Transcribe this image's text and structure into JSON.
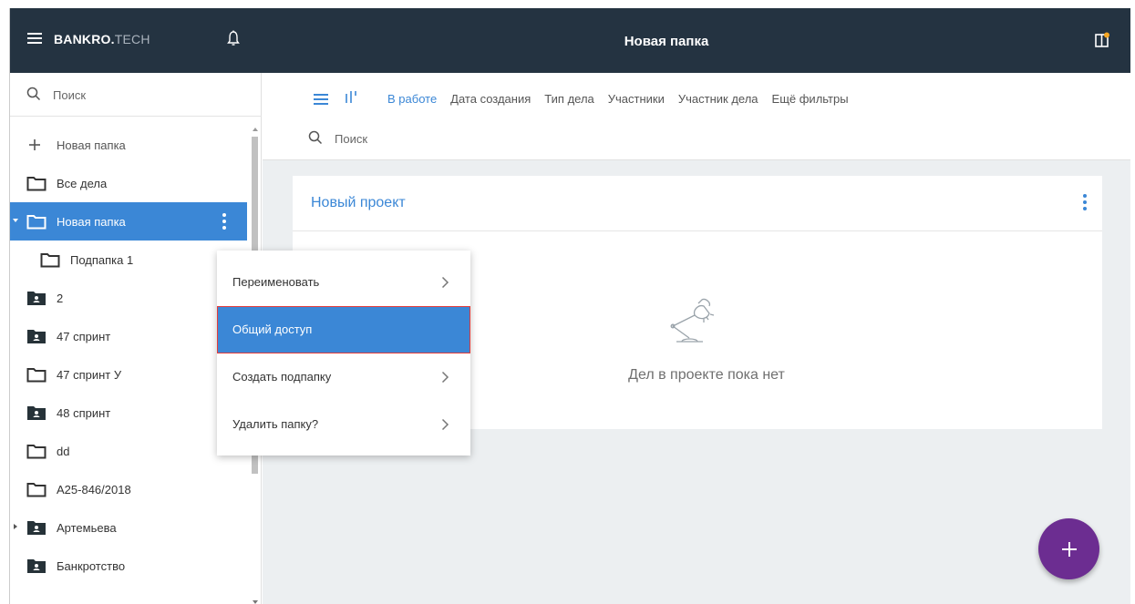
{
  "app": {
    "logo_bold": "BANKRO.",
    "logo_light": "TECH",
    "title": "Новая папка"
  },
  "sidebar": {
    "search_placeholder": "Поиск",
    "new_folder_label": "Новая папка",
    "items": [
      {
        "label": "Все дела",
        "icon": "folder-icon"
      },
      {
        "label": "Новая папка",
        "icon": "folder-icon",
        "active": true
      },
      {
        "label": "Подпапка 1",
        "icon": "folder-icon"
      },
      {
        "label": "2",
        "icon": "shared-folder-icon"
      },
      {
        "label": "47 спринт",
        "icon": "shared-folder-icon"
      },
      {
        "label": "47 спринт У",
        "icon": "folder-icon"
      },
      {
        "label": "48 спринт",
        "icon": "shared-folder-icon"
      },
      {
        "label": "dd",
        "icon": "folder-icon"
      },
      {
        "label": "А25-846/2018",
        "icon": "folder-icon"
      },
      {
        "label": "Артемьева",
        "icon": "shared-folder-icon"
      },
      {
        "label": "Банкротство",
        "icon": "shared-folder-icon"
      }
    ]
  },
  "toolbar": {
    "filters": [
      "В работе",
      "Дата создания",
      "Тип дела",
      "Участники",
      "Участник дела",
      "Ещё фильтры"
    ],
    "active_filter": "В работе",
    "search_placeholder": "Поиск"
  },
  "project": {
    "title": "Новый проект",
    "empty_text": "Дел в проекте пока нет"
  },
  "context_menu": {
    "items": [
      {
        "label": "Переименовать",
        "has_submenu": true
      },
      {
        "label": "Общий доступ",
        "has_submenu": false,
        "active": true
      },
      {
        "label": "Создать подпапку",
        "has_submenu": true
      },
      {
        "label": "Удалить папку?",
        "has_submenu": true
      }
    ]
  },
  "colors": {
    "topbar": "#243341",
    "accent": "#3b87d6",
    "fab": "#6c2d91",
    "notification_dot": "#f5a623"
  }
}
